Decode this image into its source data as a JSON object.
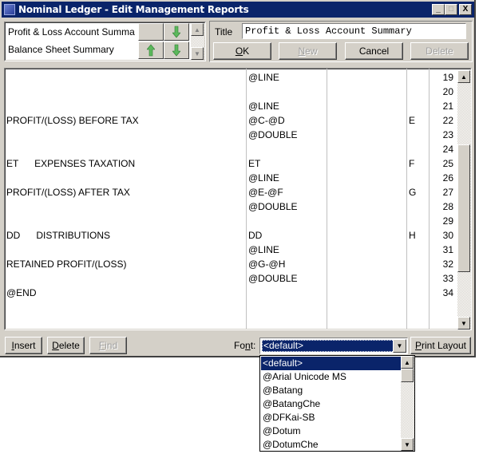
{
  "window": {
    "title": "Nominal Ledger - Edit Management Reports",
    "controls": {
      "minimize": "_",
      "maximize": "□",
      "close": "X"
    }
  },
  "report_list": {
    "items": [
      {
        "label": "Profit & Loss Account Summa",
        "up": false,
        "down": true
      },
      {
        "label": "Balance Sheet Summary",
        "up": true,
        "down": true
      }
    ]
  },
  "title_field": {
    "label": "Title",
    "value": "Profit & Loss Account Summary"
  },
  "actions": {
    "ok": "OK",
    "ok_accel": "O",
    "new": "New",
    "new_accel": "N",
    "cancel": "Cancel",
    "delete": "Delete"
  },
  "grid": {
    "rows": [
      {
        "num": "19",
        "desc": "",
        "formula": "@LINE",
        "col3": "",
        "result": ""
      },
      {
        "num": "20",
        "desc": "",
        "formula": "",
        "col3": "",
        "result": ""
      },
      {
        "num": "21",
        "desc": "",
        "formula": "@LINE",
        "col3": "",
        "result": ""
      },
      {
        "num": "22",
        "desc": "PROFIT/(LOSS) BEFORE TAX",
        "formula": "@C-@D",
        "col3": "",
        "result": "E"
      },
      {
        "num": "23",
        "desc": "",
        "formula": "@DOUBLE",
        "col3": "",
        "result": ""
      },
      {
        "num": "24",
        "desc": "",
        "formula": "",
        "col3": "",
        "result": ""
      },
      {
        "num": "25",
        "desc": "ET      EXPENSES TAXATION",
        "formula": "ET",
        "col3": "",
        "result": "F"
      },
      {
        "num": "26",
        "desc": "",
        "formula": "@LINE",
        "col3": "",
        "result": ""
      },
      {
        "num": "27",
        "desc": "PROFIT/(LOSS) AFTER TAX",
        "formula": "@E-@F",
        "col3": "",
        "result": "G"
      },
      {
        "num": "28",
        "desc": "",
        "formula": "@DOUBLE",
        "col3": "",
        "result": ""
      },
      {
        "num": "29",
        "desc": "",
        "formula": "",
        "col3": "",
        "result": ""
      },
      {
        "num": "30",
        "desc": "DD      DISTRIBUTIONS",
        "formula": "DD",
        "col3": "",
        "result": "H"
      },
      {
        "num": "31",
        "desc": "",
        "formula": "@LINE",
        "col3": "",
        "result": ""
      },
      {
        "num": "32",
        "desc": "RETAINED PROFIT/(LOSS)",
        "formula": "@G-@H",
        "col3": "",
        "result": ""
      },
      {
        "num": "33",
        "desc": "",
        "formula": "@DOUBLE",
        "col3": "",
        "result": ""
      },
      {
        "num": "34",
        "desc": "@END",
        "formula": "",
        "col3": "",
        "result": ""
      }
    ]
  },
  "bottom": {
    "insert": "Insert",
    "insert_accel": "I",
    "delete": "Delete",
    "delete_accel": "D",
    "find": "Find",
    "find_accel": "F",
    "font_label_pre": "Fo",
    "font_label_accel": "n",
    "font_label_post": "t:",
    "font_value": "<default>",
    "print_layout": "Print Layout",
    "print_accel": "P"
  },
  "font_dropdown": {
    "options": [
      "<default>",
      "@Arial Unicode MS",
      "@Batang",
      "@BatangChe",
      "@DFKai-SB",
      "@Dotum",
      "@DotumChe"
    ],
    "selected_index": 0
  },
  "colors": {
    "titlebar": "#0a246a",
    "face": "#d4d0c8",
    "arrow_green": "#4caf50"
  }
}
